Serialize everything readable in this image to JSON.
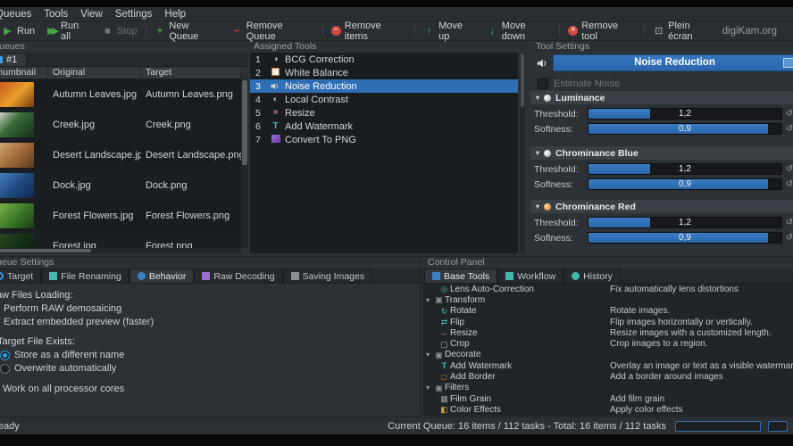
{
  "colors": {
    "accent": "#2e6eb5",
    "selection": "#2e6eb5",
    "window_bg": "#2c3135",
    "list_bg": "#191d20"
  },
  "menu": {
    "items": [
      {
        "label": "Queues"
      },
      {
        "label": "Tools"
      },
      {
        "label": "View"
      },
      {
        "label": "Settings"
      },
      {
        "label": "Help"
      }
    ]
  },
  "toolbar": {
    "run": "Run",
    "run_all": "Run all",
    "stop": "Stop",
    "new_queue": "New Queue",
    "remove_queue": "Remove Queue",
    "remove_items": "Remove items",
    "move_up": "Move up",
    "move_down": "Move down",
    "remove_tool": "Remove tool",
    "fullscreen": "Plein écran",
    "brand": "digiKam.org"
  },
  "queues": {
    "title": "Queues",
    "tab_label": "#1",
    "columns": [
      "Thumbnail",
      "Original",
      "Target"
    ],
    "rows": [
      {
        "original": "Autumn Leaves.jpg",
        "target": "Autumn Leaves.png"
      },
      {
        "original": "Creek.jpg",
        "target": "Creek.png"
      },
      {
        "original": "Desert Landscape.jpg",
        "target": "Desert Landscape.png"
      },
      {
        "original": "Dock.jpg",
        "target": "Dock.png"
      },
      {
        "original": "Forest Flowers.jpg",
        "target": "Forest Flowers.png"
      },
      {
        "original": "Forest.jpg",
        "target": "Forest.png"
      }
    ]
  },
  "assigned_tools": {
    "title": "Assigned Tools",
    "selected": "Noise Reduction",
    "items": [
      {
        "num": "1",
        "label": "BCG Correction"
      },
      {
        "num": "2",
        "label": "White Balance"
      },
      {
        "num": "3",
        "label": "Noise Reduction"
      },
      {
        "num": "4",
        "label": "Local Contrast"
      },
      {
        "num": "5",
        "label": "Resize"
      },
      {
        "num": "6",
        "label": "Add Watermark"
      },
      {
        "num": "7",
        "label": "Convert To PNG"
      }
    ]
  },
  "tool_settings": {
    "title": "Tool Settings",
    "tool_name": "Noise Reduction",
    "estimate_noise": "Estimate Noise",
    "estimate_noise_checked": false,
    "sections": [
      {
        "name": "Luminance",
        "threshold_label": "Threshold:",
        "threshold_value": "1,2",
        "threshold_fill": 32,
        "softness_label": "Softness:",
        "softness_value": "0,9",
        "softness_fill": 93
      },
      {
        "name": "Chrominance Blue",
        "threshold_label": "Threshold:",
        "threshold_value": "1,2",
        "threshold_fill": 32,
        "softness_label": "Softness:",
        "softness_value": "0,9",
        "softness_fill": 93
      },
      {
        "name": "Chrominance Red",
        "threshold_label": "Threshold:",
        "threshold_value": "1,2",
        "threshold_fill": 32,
        "softness_label": "Softness:",
        "softness_value": "0,9",
        "softness_fill": 93
      }
    ]
  },
  "queue_settings": {
    "title": "Queue Settings",
    "tabs": [
      {
        "label": "Target"
      },
      {
        "label": "File Renaming"
      },
      {
        "label": "Behavior"
      },
      {
        "label": "Raw Decoding"
      },
      {
        "label": "Saving Images"
      }
    ],
    "active_tab": "Behavior",
    "raw_heading": "Raw Files Loading:",
    "opt_demosaic": "Perform RAW demosaicing",
    "opt_preview": "Extract embedded preview (faster)",
    "raw_selected": "Extract embedded preview (faster)",
    "exists_heading": "If Target File Exists:",
    "opt_store": "Store as a different name",
    "opt_overwrite": "Overwrite automatically",
    "exists_selected": "Store as a different name",
    "all_cores": "Work on all processor cores",
    "all_cores_checked": true
  },
  "control_panel": {
    "title": "Control Panel",
    "tabs": [
      {
        "label": "Base Tools"
      },
      {
        "label": "Workflow"
      },
      {
        "label": "History"
      }
    ],
    "active_tab": "Base Tools",
    "tree": [
      {
        "label": "Lens Auto-Correction",
        "desc": "Fix automatically lens distortions"
      },
      {
        "label": "Transform"
      },
      {
        "label": "Rotate",
        "desc": "Rotate images."
      },
      {
        "label": "Flip",
        "desc": "Flip images horizontally or vertically."
      },
      {
        "label": "Resize",
        "desc": "Resize images with a customized length."
      },
      {
        "label": "Crop",
        "desc": "Crop images to a region."
      },
      {
        "label": "Decorate"
      },
      {
        "label": "Add Watermark",
        "desc": "Overlay an image or text as a visible watermark"
      },
      {
        "label": "Add Border",
        "desc": "Add a border around images"
      },
      {
        "label": "Filters"
      },
      {
        "label": "Film Grain",
        "desc": "Add film grain"
      },
      {
        "label": "Color Effects",
        "desc": "Apply color effects"
      }
    ]
  },
  "status": {
    "left": "Ready",
    "right": "Current Queue: 16 items / 112 tasks - Total: 16 items / 112 tasks"
  }
}
